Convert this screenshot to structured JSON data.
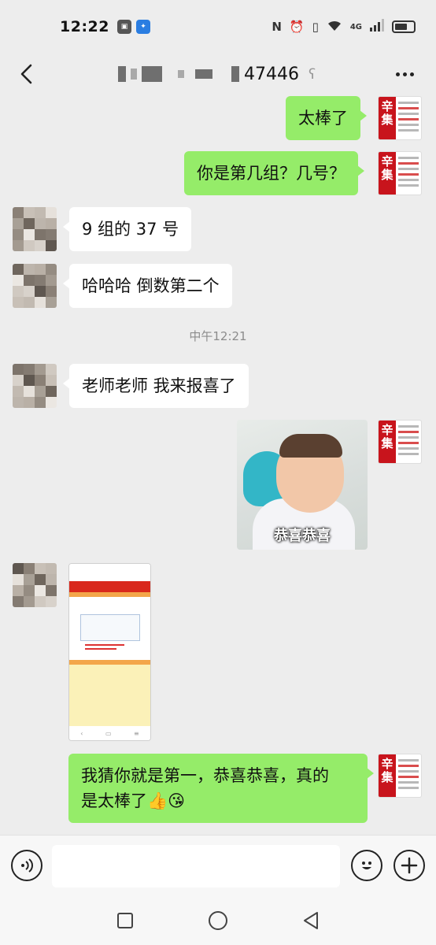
{
  "status_bar": {
    "time": "12:22",
    "network": "4G",
    "battery_percent": 70
  },
  "header": {
    "title_visible": "47446"
  },
  "messages": [
    {
      "side": "out",
      "text": "太棒了"
    },
    {
      "side": "out",
      "text": "你是第几组？几号？"
    },
    {
      "side": "in",
      "text": "9 组的 37 号"
    },
    {
      "side": "in",
      "text": "哈哈哈 倒数第二个"
    },
    {
      "side": "in",
      "text": "老师老师 我来报喜了"
    },
    {
      "side": "out",
      "type": "sticker",
      "caption": "恭喜恭喜"
    },
    {
      "side": "in",
      "type": "screenshot"
    },
    {
      "side": "out",
      "text_line1": "我猜你就是第一，恭喜恭喜，真的",
      "text_line2": "是太棒了",
      "emoji": "👍😘"
    }
  ],
  "time_divider": "中午12:21",
  "self_avatar": {
    "glyph_top": "辛",
    "glyph_bottom": "集"
  },
  "colors": {
    "outgoing_bubble": "#95ec69",
    "incoming_bubble": "#ffffff",
    "background": "#ededed"
  },
  "icons": {
    "back": "back-arrow-icon",
    "more": "more-dots-icon",
    "voice": "voice-icon",
    "emoji": "emoji-icon",
    "plus": "plus-icon"
  }
}
